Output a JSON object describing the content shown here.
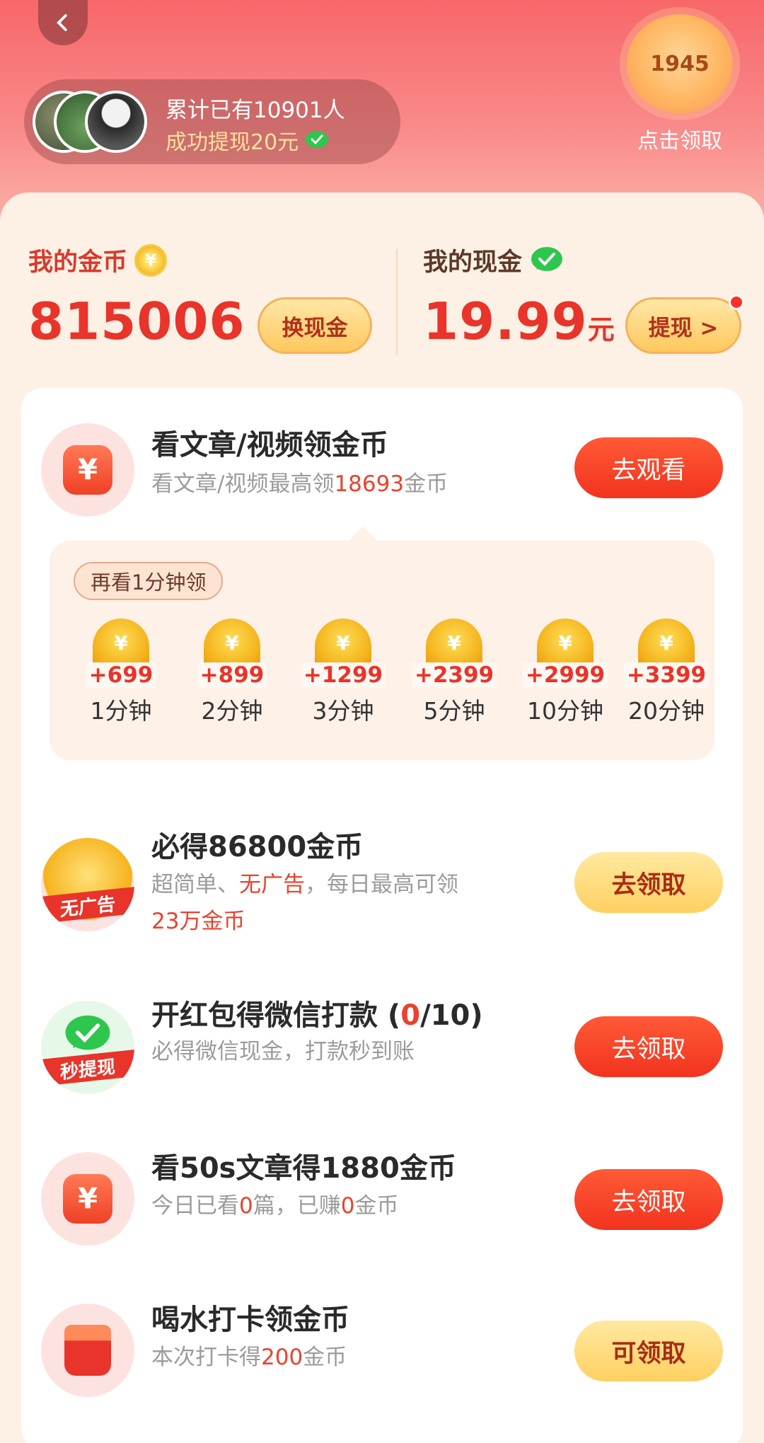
{
  "header": {
    "ticker_line1": "累计已有10901人",
    "ticker_line2": "成功提现20元",
    "reward_coins": "1945",
    "reward_label": "点击领取"
  },
  "wallet": {
    "coins_label": "我的金币",
    "coins_value": "815006",
    "exchange_button": "换现金",
    "cash_label": "我的现金",
    "cash_value": "19.99",
    "cash_unit": "元",
    "withdraw_button": "提现 >"
  },
  "tasks": {
    "watch": {
      "title": "看文章/视频领金币",
      "sub_prefix": "看文章/视频最高领",
      "sub_highlight": "18693",
      "sub_suffix": "金币",
      "button": "去观看",
      "tip": "再看1分钟领",
      "milestones": [
        {
          "bonus": "+699",
          "time": "1分钟"
        },
        {
          "bonus": "+899",
          "time": "2分钟"
        },
        {
          "bonus": "+1299",
          "time": "3分钟"
        },
        {
          "bonus": "+2399",
          "time": "5分钟"
        },
        {
          "bonus": "+2999",
          "time": "10分钟"
        },
        {
          "bonus": "+3399",
          "time": "20分钟"
        }
      ]
    },
    "noad": {
      "title": "必得86800金币",
      "badge": "无广告",
      "sub1_a": "超简单、",
      "sub1_b": "无广告",
      "sub1_c": "，每日最高可领",
      "sub2": "23万金币",
      "button": "去领取"
    },
    "hongbao": {
      "title_a": "开红包得微信打款 (",
      "title_b": "0",
      "title_c": "/10)",
      "badge": "秒提现",
      "sub": "必得微信现金，打款秒到账",
      "button": "去领取"
    },
    "article": {
      "title": "看50s文章得1880金币",
      "sub_a": "今日已看",
      "sub_b": "0",
      "sub_c": "篇，已赚",
      "sub_d": "0",
      "sub_e": "金币",
      "button": "去领取"
    },
    "water": {
      "title": "喝水打卡领金币",
      "sub_a": "本次打卡得",
      "sub_b": "200",
      "sub_c": "金币",
      "button": "可领取"
    }
  },
  "icons": {
    "yen": "¥"
  },
  "colors": {
    "accent_red": "#e8342a",
    "gold": "#ffd061",
    "hero_pink": "#f8676a"
  }
}
